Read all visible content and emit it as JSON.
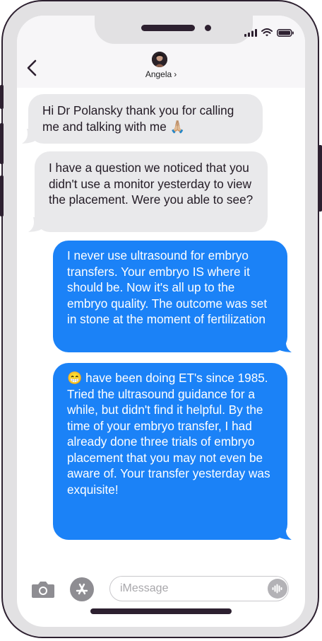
{
  "contact": {
    "name": "Angela",
    "chevron": "›",
    "avatar": "avatar-photo"
  },
  "status_bar": {
    "icons": [
      "cellular-signal-icon",
      "wifi-icon",
      "battery-icon"
    ]
  },
  "header": {
    "back_icon": "chevron-left-icon"
  },
  "messages": [
    {
      "direction": "received",
      "text": "Hi Dr Polansky thank you for calling me and talking with me 🙏🏼"
    },
    {
      "direction": "received",
      "text": "I have a question we noticed that you didn't use a monitor yesterday to view the placement. Were you able to see?"
    },
    {
      "direction": "sent",
      "text": "I never use ultrasound for embryo transfers. Your embryo IS where it should be. Now it's all up to the embryo quality. The outcome was set in stone at the moment of fertilization"
    },
    {
      "direction": "sent",
      "text": "😁 have been doing ET's since 1985. Tried the ultrasound guidance for a while, but didn't find it helpful. By the time of your embryo transfer, I had already done three trials of embryo placement that you may not even be aware of. Your transfer yesterday was exquisite!"
    }
  ],
  "compose": {
    "placeholder": "iMessage",
    "value": ""
  },
  "colors": {
    "sent_bubble": "#1b82f7",
    "received_bubble": "#e9e9eb",
    "frame": "#e2e1e3",
    "frame_outline": "#2d2030"
  }
}
